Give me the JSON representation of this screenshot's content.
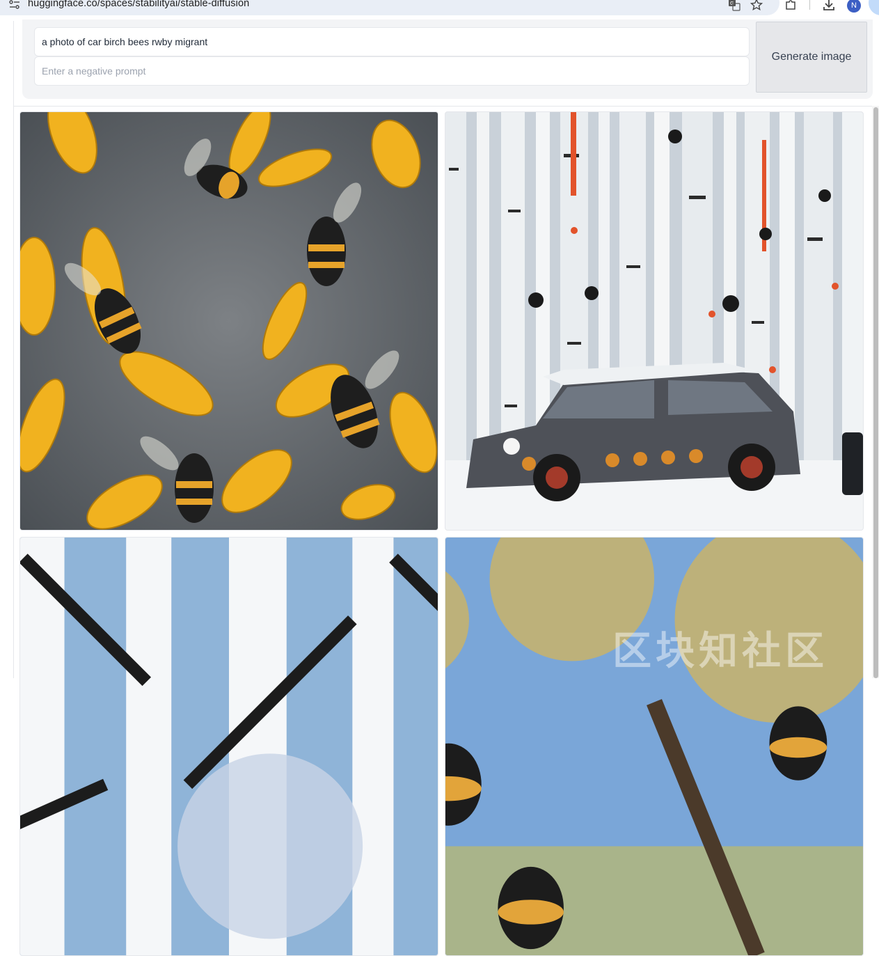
{
  "browser": {
    "url": "huggingface.co/spaces/stabilityai/stable-diffusion",
    "profile_initial": "N",
    "accent_color": "#3c5fc4"
  },
  "form": {
    "prompt_value": "a photo of car birch bees rwby migrant",
    "negative_placeholder": "Enter a negative prompt",
    "generate_label": "Generate image"
  },
  "gallery": {
    "images": [
      {
        "name": "bees-on-yellow-petals"
      },
      {
        "name": "car-in-birch-forest"
      },
      {
        "name": "winter-birch-trees"
      },
      {
        "name": "bees-in-birch-tree"
      }
    ]
  },
  "watermark": "区块知社区"
}
